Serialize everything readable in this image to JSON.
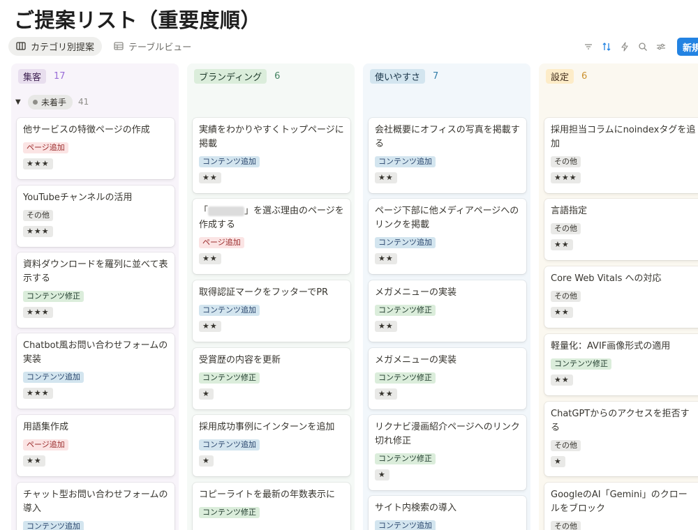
{
  "title": "ご提案リスト（重要度順）",
  "views": [
    {
      "label": "カテゴリ別提案",
      "icon": "board-columns-icon",
      "active": true
    },
    {
      "label": "テーブルビュー",
      "icon": "table-icon",
      "active": false
    }
  ],
  "toolbar": {
    "icons": [
      "filter-icon",
      "sort-icon",
      "lightning-icon",
      "search-icon",
      "settings-sliders-icon"
    ],
    "new_label": "新規"
  },
  "colors": {
    "accent_blue": "#2383e2",
    "tag_page_add_bg": "#fbe4e4",
    "tag_page_add_fg": "#9b2c2c",
    "tag_content_add_bg": "#d3e5ef",
    "tag_content_add_fg": "#28456c",
    "tag_content_fix_bg": "#dbeddb",
    "tag_content_fix_fg": "#1c3829",
    "tag_other_bg": "#e9e9e7",
    "tag_other_fg": "#37352f"
  },
  "group": {
    "label": "未着手",
    "count": "41"
  },
  "columns": [
    {
      "name": "集客",
      "count": "17",
      "cards": [
        {
          "title": "他サービスの特徴ページの作成",
          "tag": "ページ追加",
          "stars": "★★★"
        },
        {
          "title": "YouTubeチャンネルの活用",
          "tag": "その他",
          "stars": "★★★"
        },
        {
          "title": "資料ダウンロードを羅列に並べて表示する",
          "tag": "コンテンツ修正",
          "stars": "★★★"
        },
        {
          "title": "Chatbot風お問い合わせフォームの実装",
          "tag": "コンテンツ追加",
          "stars": "★★★"
        },
        {
          "title": "用語集作成",
          "tag": "ページ追加",
          "stars": "★★"
        },
        {
          "title": "チャット型お問い合わせフォームの導入",
          "tag": "コンテンツ追加",
          "stars": ""
        }
      ]
    },
    {
      "name": "ブランディング",
      "count": "6",
      "cards": [
        {
          "title": "実績をわかりやすくトップページに掲載",
          "tag": "コンテンツ追加",
          "stars": "★★"
        },
        {
          "title_prefix": "「",
          "title": "」を選ぶ理由のページを作成する",
          "tag": "ページ追加",
          "stars": "★★"
        },
        {
          "title": "取得認証マークをフッターでPR",
          "tag": "コンテンツ追加",
          "stars": "★★"
        },
        {
          "title": "受賞歴の内容を更新",
          "tag": "コンテンツ修正",
          "stars": "★"
        },
        {
          "title": "採用成功事例にインターンを追加",
          "tag": "コンテンツ追加",
          "stars": "★"
        },
        {
          "title": "コピーライトを最新の年数表示に",
          "tag": "コンテンツ修正",
          "stars": ""
        }
      ]
    },
    {
      "name": "使いやすさ",
      "count": "7",
      "cards": [
        {
          "title": "会社概要にオフィスの写真を掲載する",
          "tag": "コンテンツ追加",
          "stars": "★★"
        },
        {
          "title": "ページ下部に他メディアページへのリンクを掲載",
          "tag": "コンテンツ追加",
          "stars": "★★"
        },
        {
          "title": "メガメニューの実装",
          "tag": "コンテンツ修正",
          "stars": "★★"
        },
        {
          "title": "メガメニューの実装",
          "tag": "コンテンツ修正",
          "stars": "★★"
        },
        {
          "title": "リクナビ漫画紹介ページへのリンク切れ修正",
          "tag": "コンテンツ修正",
          "stars": "★"
        },
        {
          "title": "サイト内検索の導入",
          "tag": "コンテンツ追加",
          "stars": ""
        }
      ]
    },
    {
      "name": "設定",
      "count": "6",
      "cards": [
        {
          "title": "採用担当コラムにnoindexタグを追加",
          "tag": "その他",
          "stars": "★★★"
        },
        {
          "title": "言語指定",
          "tag": "その他",
          "stars": "★★"
        },
        {
          "title": "Core Web Vitals への対応",
          "tag": "その他",
          "stars": "★★"
        },
        {
          "title": "軽量化：AVIF画像形式の適用",
          "tag": "コンテンツ修正",
          "stars": "★★"
        },
        {
          "title": "ChatGPTからのアクセスを拒否する",
          "tag": "その他",
          "stars": "★"
        },
        {
          "title": "GoogleのAI「Gemini」のクロールをブロック",
          "tag": "その他",
          "stars": ""
        }
      ]
    }
  ]
}
